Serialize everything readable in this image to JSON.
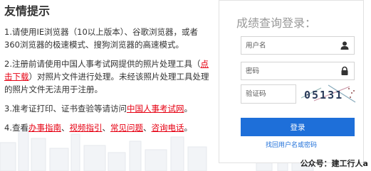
{
  "tips": {
    "title": "友情提示",
    "t1": "1.请使用IE浏览器（10以上版本）、谷歌浏览器，或者360浏览器的极速模式、搜狗浏览器的高速模式。",
    "t2_a": "2.注册前请使用中国人事考试网提供的照片处理工具（",
    "t2_link": "点击下载",
    "t2_b": "）对照片文件进行处理。未经该照片处理工具处理的照片文件无法用于注册。",
    "t3_a": "3.准考证打印、证书查验等请访问",
    "t3_link": "中国人事考试网",
    "t3_b": "。",
    "t4_a": "4.查看",
    "t4_l1": "办事指南",
    "t4_l2": "视频指引",
    "t4_l3": "常见问题",
    "t4_l4": "咨询电话",
    "sep": "、",
    "end": "。"
  },
  "login": {
    "title": "成绩查询登录：",
    "username_placeholder": "用户名",
    "password_placeholder": "密码",
    "captcha_placeholder": "验证码",
    "captcha_text": "05131",
    "submit": "登录",
    "forgot": "找回用户名或密码"
  },
  "watermark": "公众号：建工行人a",
  "colors": {
    "link": "#e60012",
    "primary": "#1e6fd9"
  }
}
